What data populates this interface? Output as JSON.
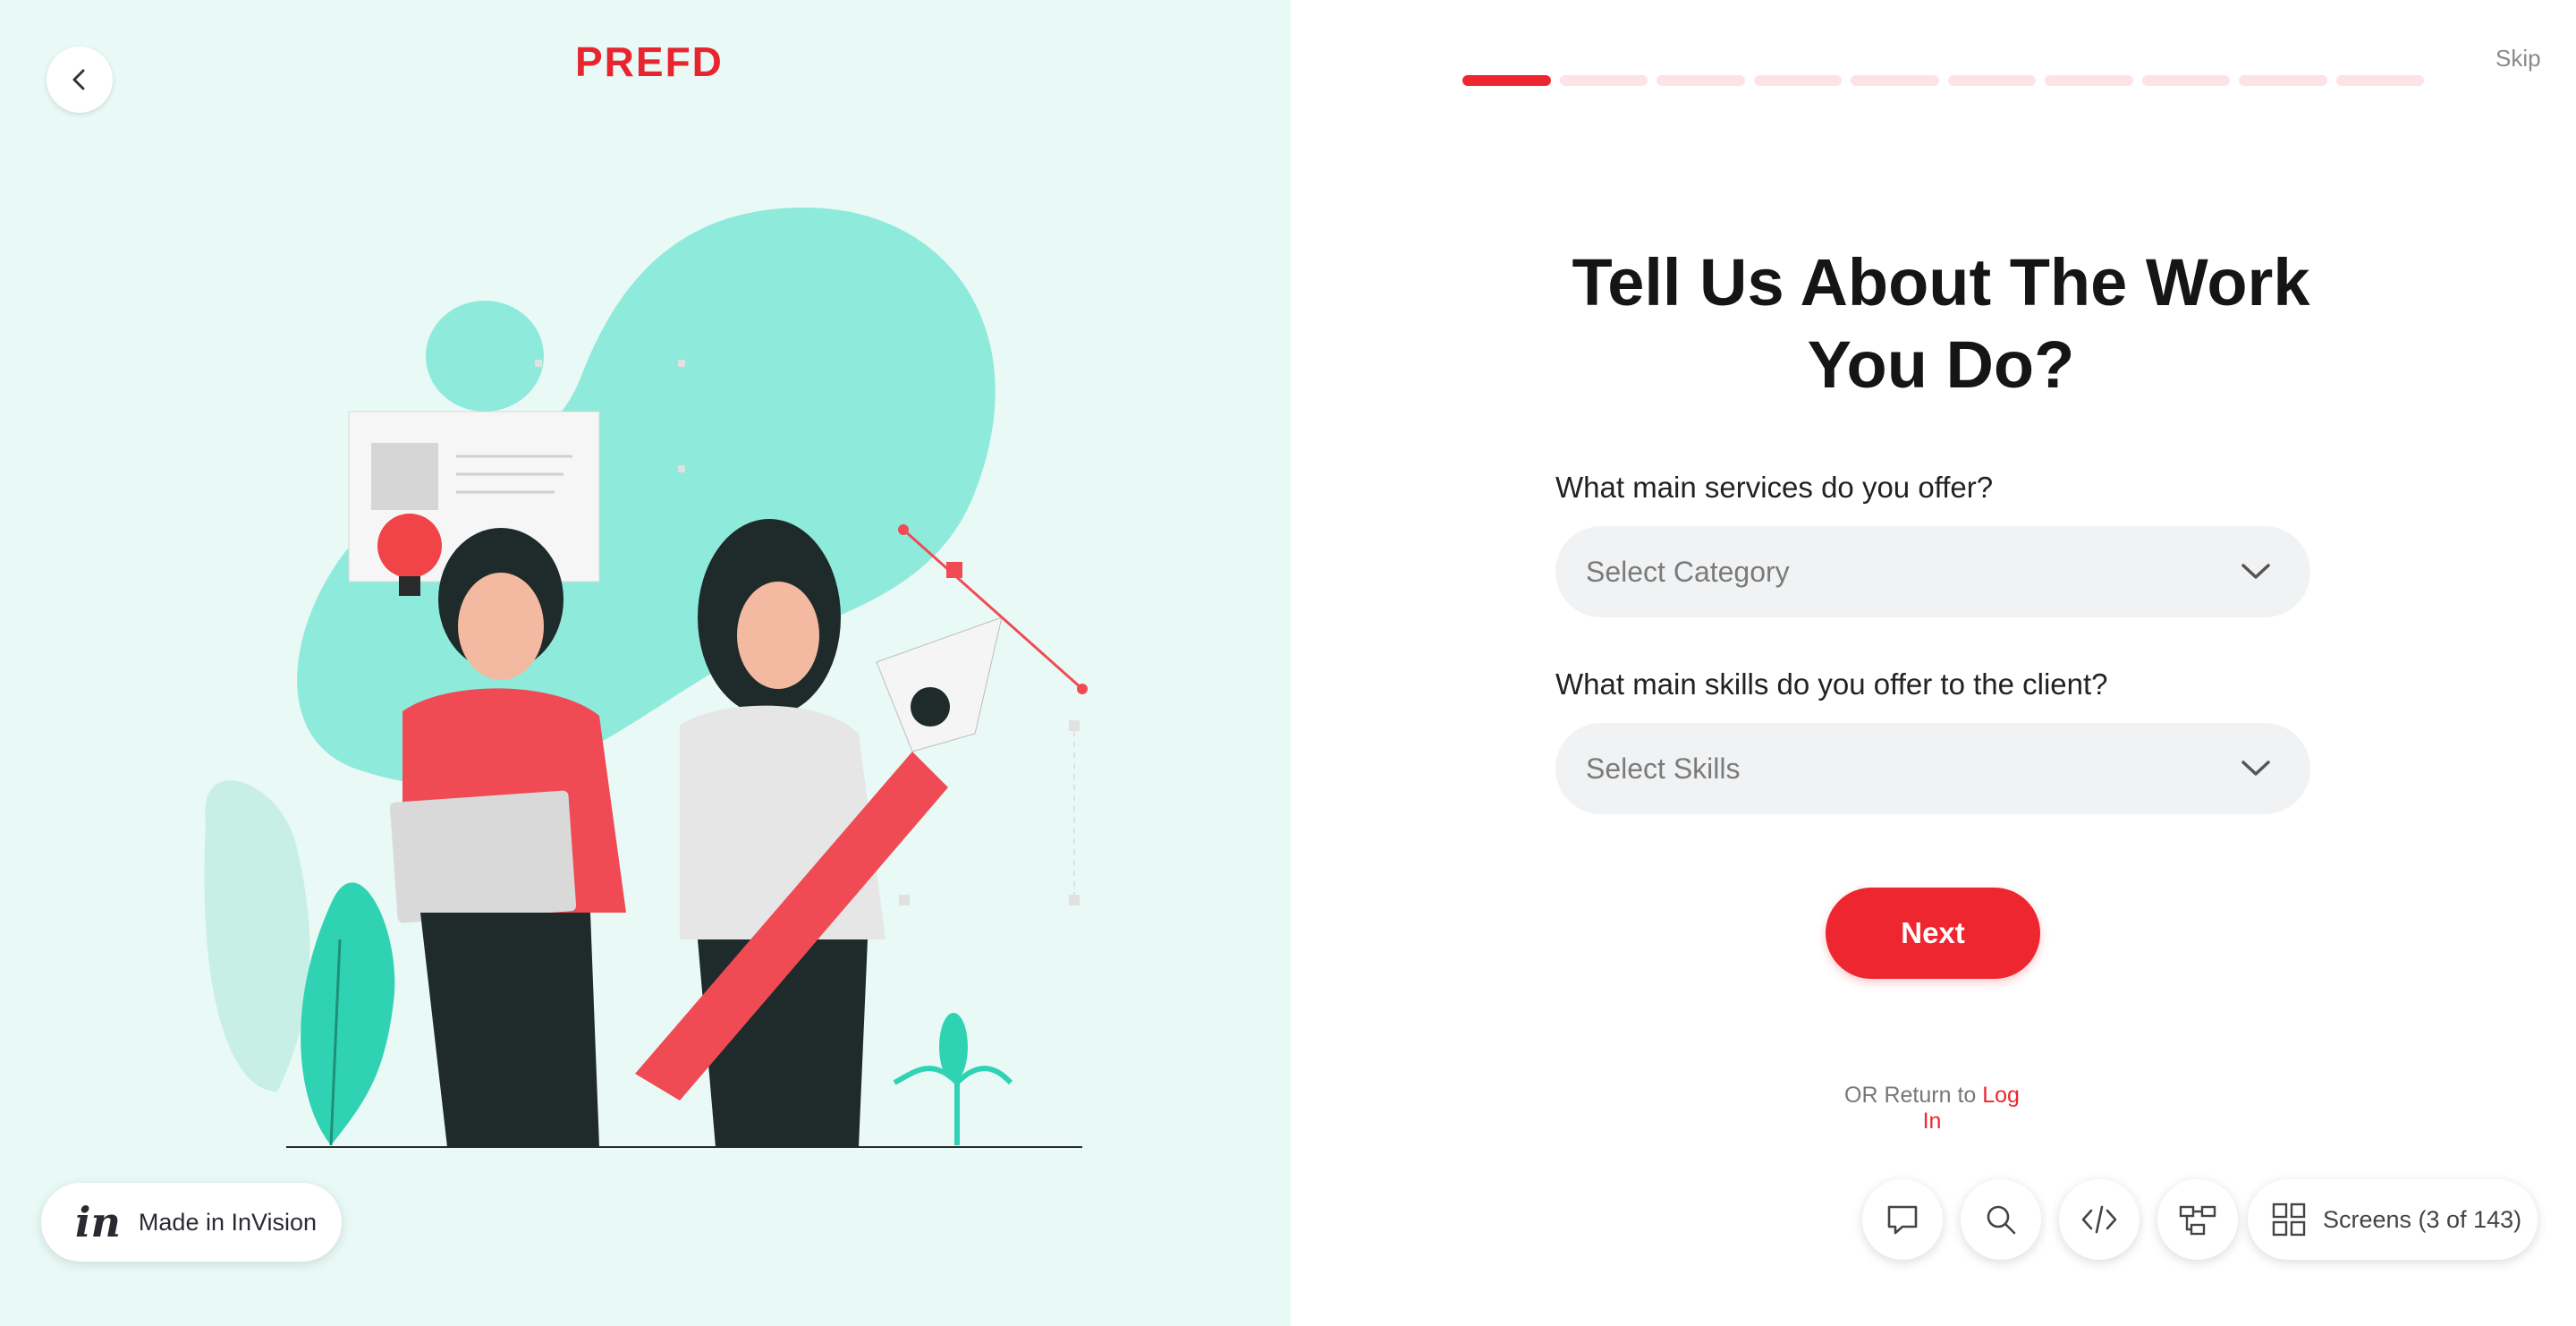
{
  "app": {
    "logo": "PREFD",
    "brand_color": "#ee2630"
  },
  "header": {
    "back_icon": "chevron-left-icon",
    "skip_label": "Skip",
    "progress": {
      "total_steps": 10,
      "current_step": 1
    }
  },
  "main": {
    "title_line1": "Tell Us About The Work",
    "title_line2": "You Do?",
    "services": {
      "label": "What main services do you offer?",
      "placeholder": "Select Category"
    },
    "skills": {
      "label": "What main skills do you offer to the client?",
      "placeholder": "Select Skills"
    },
    "next_label": "Next",
    "return_prefix": "OR Return to",
    "login_label": "Log In"
  },
  "invision": {
    "badge_icon": "in",
    "badge_label": "Made in InVision"
  },
  "toolbar": {
    "icons": [
      "comment-icon",
      "search-icon",
      "code-icon",
      "flow-icon",
      "grid-icon"
    ],
    "screens_label": "Screens (3 of 143)"
  }
}
